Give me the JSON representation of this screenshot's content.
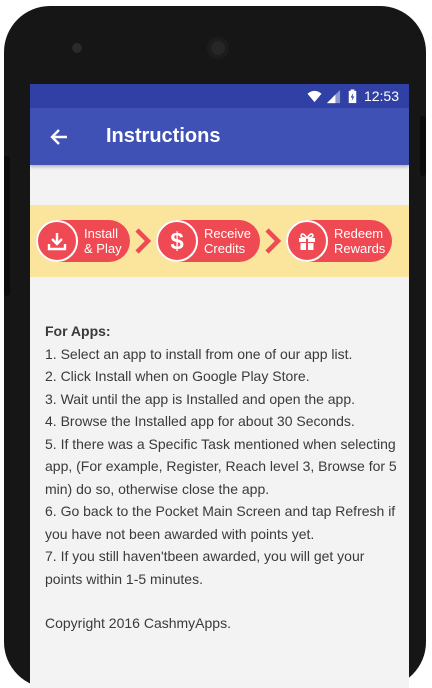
{
  "status_bar": {
    "time": "12:53"
  },
  "app_bar": {
    "title": "Instructions",
    "back_icon": "arrow-back-icon"
  },
  "banner": {
    "background": "#fbe59d",
    "accent": "#ef4a53",
    "steps": [
      {
        "icon": "download-icon",
        "line1": "Install",
        "line2": "& Play"
      },
      {
        "icon": "dollar-icon",
        "line1": "Receive",
        "line2": "Credits"
      },
      {
        "icon": "gift-icon",
        "line1": "Redeem",
        "line2": "Rewards"
      }
    ]
  },
  "content": {
    "heading": "For Apps:",
    "steps": [
      "1. Select an app to install from one of our app list.",
      "2. Click Install when on Google Play Store.",
      "3. Wait until the app is Installed and open the app.",
      "4. Browse the Installed app for about 30 Seconds.",
      "5. If there was a Specific Task mentioned when selecting app, (For example, Register, Reach level 3, Browse for 5 min) do so, otherwise close the app.",
      "6. Go back to the Pocket Main Screen and tap Refresh if you have not been awarded with points yet.",
      "7. If you still haven'tbeen awarded, you will get your points within 1-5 minutes."
    ],
    "copyright": "Copyright 2016 CashmyApps."
  },
  "colors": {
    "app_bar": "#3f51b5",
    "status_bar": "#3140a5"
  }
}
